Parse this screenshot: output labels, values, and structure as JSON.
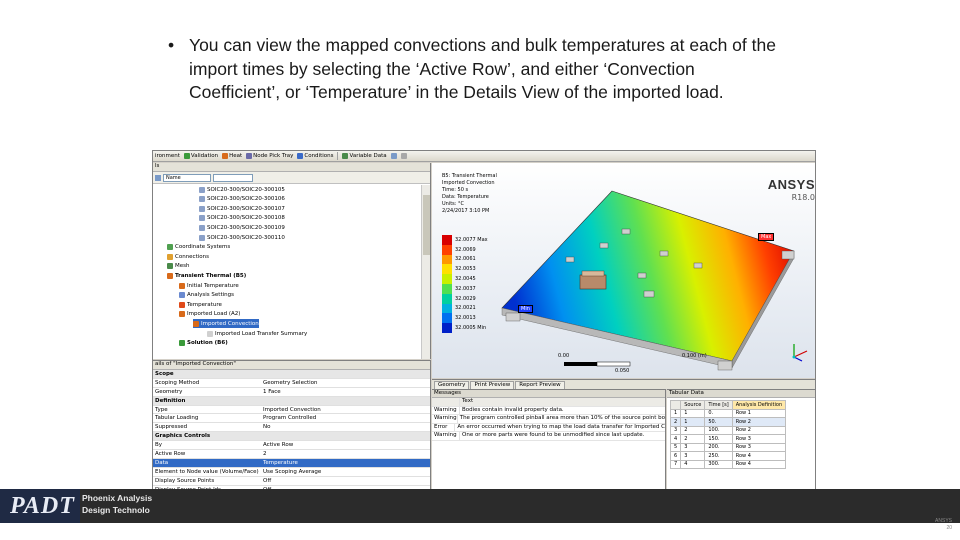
{
  "slide": {
    "bullet_symbol": "•",
    "bullet_text": "You can view the mapped convections and bulk temperatures at each of the import times by selecting the ‘Active Row’, and either ‘Convection Coefficient’, or ‘Temperature’ in the Details View of the imported load."
  },
  "toolbar": {
    "items": [
      "ironment",
      "Validation",
      "Heat",
      "Node Pick Tray",
      "Conditions",
      "Variable Data"
    ]
  },
  "tree": {
    "header": "ls",
    "filter_label": "Name",
    "rows": [
      "SOIC20-300/SOIC20-300105",
      "SOIC20-300/SOIC20-300106",
      "SOIC20-300/SOIC20-300107",
      "SOIC20-300/SOIC20-300108",
      "SOIC20-300/SOIC20-300109",
      "SOIC20-300/SOIC20-300110",
      "Coordinate Systems",
      "Connections",
      "Mesh",
      "Transient Thermal (B5)",
      "Initial Temperature",
      "Analysis Settings",
      "Temperature",
      "Imported Load (A2)",
      "Imported Convection",
      "Imported Load Transfer Summary",
      "Solution (B6)"
    ]
  },
  "details": {
    "title": "ails of \"Imported Convection\"",
    "rows": [
      {
        "k": "Scope",
        "v": "",
        "t": "grp"
      },
      {
        "k": "Scoping Method",
        "v": "Geometry Selection",
        "t": ""
      },
      {
        "k": "Geometry",
        "v": "1 Face",
        "t": ""
      },
      {
        "k": "Definition",
        "v": "",
        "t": "grp"
      },
      {
        "k": "Type",
        "v": "Imported Convection",
        "t": ""
      },
      {
        "k": "Tabular Loading",
        "v": "Program Controlled",
        "t": ""
      },
      {
        "k": "Suppressed",
        "v": "No",
        "t": ""
      },
      {
        "k": "Graphics Controls",
        "v": "",
        "t": "grp"
      },
      {
        "k": "By",
        "v": "Active Row",
        "t": ""
      },
      {
        "k": "Active Row",
        "v": "2",
        "t": ""
      },
      {
        "k": "Data",
        "v": "Temperature",
        "t": "sel"
      },
      {
        "k": "Element to Node value (Volume/Face)",
        "v": "Use Scoping Average",
        "t": ""
      },
      {
        "k": "Display Source Points",
        "v": "Off",
        "t": ""
      },
      {
        "k": "Display Source Point Ids",
        "v": "Off",
        "t": ""
      },
      {
        "k": "ute Options (Beta)",
        "v": "",
        "t": "grp"
      }
    ]
  },
  "viewport": {
    "logo": "ANSYS",
    "version": "R18.0",
    "info_lines": [
      "B5: Transient Thermal",
      "Imported Convection",
      "Time: 50 s",
      "Data: Temperature",
      "Units: °C",
      "2/24/2017 3:10 PM"
    ],
    "legend": [
      {
        "label": "32.0077 Max",
        "color": "#d80000"
      },
      {
        "label": "32.0069",
        "color": "#ff4000"
      },
      {
        "label": "32.0061",
        "color": "#ff9800"
      },
      {
        "label": "32.0053",
        "color": "#ffe000"
      },
      {
        "label": "32.0045",
        "color": "#c8f000"
      },
      {
        "label": "32.0037",
        "color": "#50e050"
      },
      {
        "label": "32.0029",
        "color": "#00d0a0"
      },
      {
        "label": "32.0021",
        "color": "#00b0e0"
      },
      {
        "label": "32.0013",
        "color": "#0070f0"
      },
      {
        "label": "32.0005 Min",
        "color": "#0020c8"
      }
    ],
    "scale_left": "0.00",
    "scale_mid": "0.050",
    "scale_right": "0.100 (m)",
    "tag_max": "Max",
    "tag_min": "Min"
  },
  "tabs": [
    "Geometry",
    "Print Preview",
    "Report Preview"
  ],
  "messages": {
    "title": "Messages",
    "col_text": "Text",
    "rows": [
      {
        "type": "Warning",
        "text": "Bodies contain invalid property data."
      },
      {
        "type": "Warning",
        "text": "The program controlled pinball area more than 10% of the source point bo"
      },
      {
        "type": "Error",
        "text": "An error occurred when trying to map the load data transfer for Imported C"
      },
      {
        "type": "Warning",
        "text": "One or more parts were found to be unmodified since last update."
      }
    ],
    "bottom_tabs": [
      "Graph",
      "Tab Data",
      "Messages"
    ]
  },
  "tabular": {
    "title": "Tabular Data",
    "headers": [
      "",
      "Source",
      "Time [s]",
      "Analysis Definition"
    ],
    "rows": [
      [
        "1",
        "1",
        "0.",
        "Row 1"
      ],
      [
        "2",
        "1",
        "50.",
        "Row 2"
      ],
      [
        "3",
        "2",
        "100.",
        "Row 2"
      ],
      [
        "4",
        "2",
        "150.",
        "Row 3"
      ],
      [
        "5",
        "3",
        "200.",
        "Row 3"
      ],
      [
        "6",
        "3",
        "250.",
        "Row 4"
      ],
      [
        "7",
        "4",
        "300.",
        "Row 4"
      ]
    ],
    "highlight_row": 1
  },
  "footer": {
    "logo": "PADT",
    "company_line1": "Phoenix Analysis",
    "company_line2": "Design Technolo",
    "corner_line1": "ANSYS",
    "corner_line2": "20"
  }
}
